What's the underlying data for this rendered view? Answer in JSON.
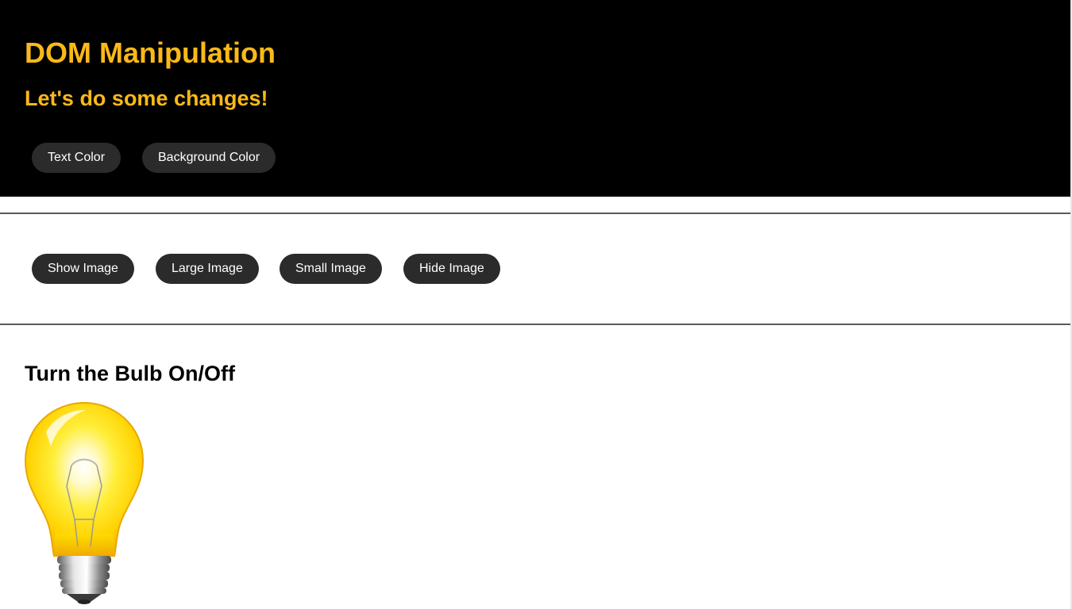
{
  "header": {
    "title": "DOM Manipulation",
    "subtitle": "Let's do some changes!",
    "background_color": "#000000",
    "text_color": "#FBB917",
    "buttons": {
      "text_color": "Text Color",
      "background_color": "Background Color"
    }
  },
  "image_controls": {
    "show": "Show Image",
    "large": "Large Image",
    "small": "Small Image",
    "hide": "Hide Image"
  },
  "bulb": {
    "heading": "Turn the Bulb On/Off",
    "state": "on",
    "icon": "lightbulb-icon"
  },
  "colors": {
    "button_bg": "#2b2b2b",
    "button_text": "#ffffff",
    "divider": "#5a5a5a"
  }
}
